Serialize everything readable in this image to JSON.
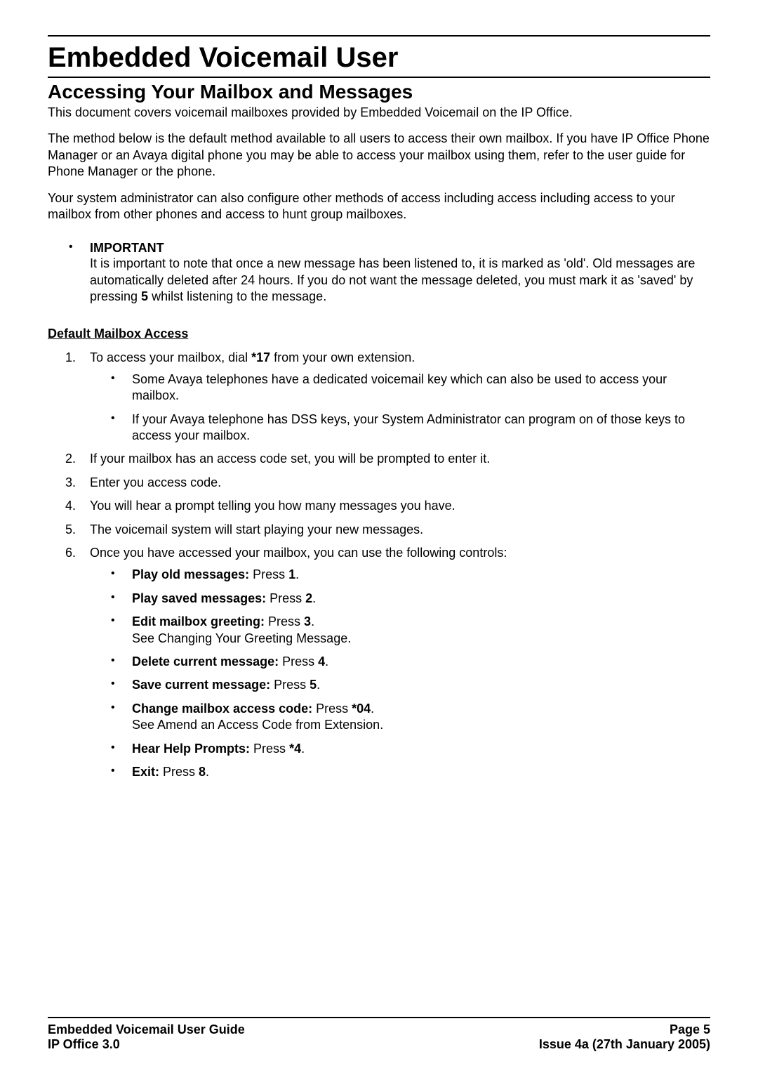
{
  "title": "Embedded Voicemail User",
  "section": "Accessing Your Mailbox and Messages",
  "p1": "This document covers voicemail mailboxes provided by Embedded Voicemail on the IP Office.",
  "p2": "The method below is the default method available to all users to access their own mailbox. If you have IP Office Phone Manager or an Avaya digital phone you may be able to access your mailbox using them, refer to the user guide for Phone Manager or the phone.",
  "p3": "Your system administrator can also configure other methods of access including access including access to your mailbox from other phones and access to hunt group mailboxes.",
  "important": {
    "label": "IMPORTANT",
    "t1": "It is important to note that once a new message has been listened to, it is marked as 'old'. Old messages are automatically deleted after 24 hours. If you do not want the message deleted, you must mark it as 'saved' by pressing ",
    "key": "5",
    "t2": " whilst listening to the message."
  },
  "subhead": "Default Mailbox Access",
  "steps": {
    "s1a": "To access your mailbox, dial ",
    "s1key": "*17",
    "s1b": " from your own extension.",
    "s1sub1": "Some Avaya telephones have a dedicated voicemail key which can also be used to access your mailbox.",
    "s1sub2": "If your Avaya telephone has DSS keys, your System Administrator can program on of those keys to access your mailbox.",
    "s2": "If your mailbox has an access code set, you will be prompted to enter it.",
    "s3": "Enter you access code.",
    "s4": "You will hear a prompt telling you how many messages you have.",
    "s5": "The voicemail system will start playing your new messages.",
    "s6": "Once you have accessed your mailbox, you can use the following controls:"
  },
  "controls": {
    "c1b": "Play old messages:",
    "c1t": " Press ",
    "c1k": "1",
    "c1e": ".",
    "c2b": "Play saved messages:",
    "c2t": " Press ",
    "c2k": "2",
    "c2e": ".",
    "c3b": "Edit mailbox greeting:",
    "c3t": " Press ",
    "c3k": "3",
    "c3e": ".",
    "c3note": "See Changing Your Greeting Message.",
    "c4b": "Delete current message:",
    "c4t": " Press ",
    "c4k": "4",
    "c4e": ".",
    "c5b": "Save current message:",
    "c5t": " Press ",
    "c5k": "5",
    "c5e": ".",
    "c6b": "Change mailbox access code:",
    "c6t": " Press ",
    "c6k": "*04",
    "c6e": ".",
    "c6note": "See Amend an Access Code from Extension.",
    "c7b": "Hear Help Prompts:",
    "c7t": " Press ",
    "c7k": "*4",
    "c7e": ".",
    "c8b": "Exit:",
    "c8t": " Press ",
    "c8k": "8",
    "c8e": "."
  },
  "footer": {
    "leftTop": "Embedded Voicemail User Guide",
    "leftBottom": "IP Office 3.0",
    "rightTop": "Page 5",
    "rightBottom": "Issue 4a (27th January 2005)"
  }
}
